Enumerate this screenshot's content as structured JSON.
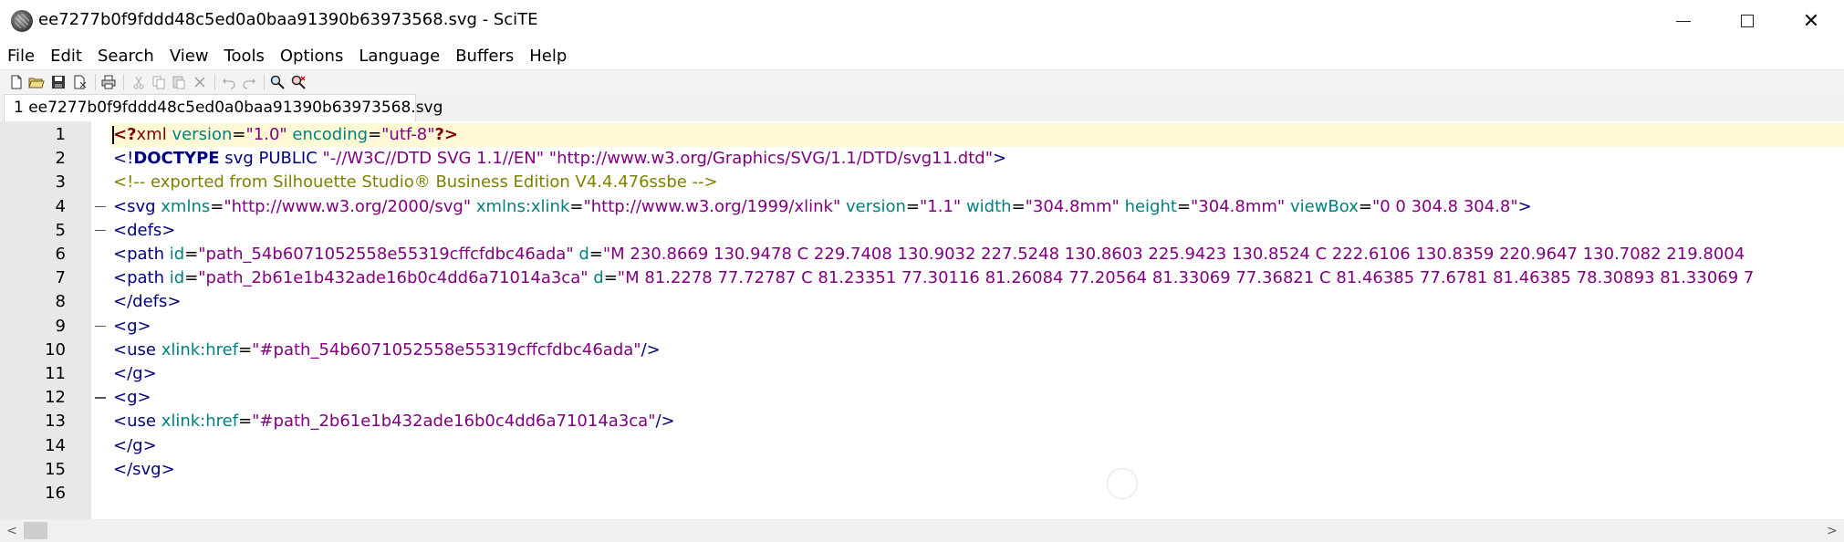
{
  "window": {
    "title": "ee7277b0f9fddd48c5ed0a0baa91390b63973568.svg - SciTE",
    "minimize_label": "",
    "close_label": "✕"
  },
  "menu": [
    "File",
    "Edit",
    "Search",
    "View",
    "Tools",
    "Options",
    "Language",
    "Buffers",
    "Help"
  ],
  "toolbar": {
    "icons": [
      "new-file-icon",
      "open-folder-icon",
      "save-icon",
      "save-as-icon",
      "print-icon",
      "cut-icon",
      "copy-icon",
      "paste-icon",
      "delete-icon",
      "undo-icon",
      "redo-icon",
      "find-icon",
      "replace-icon"
    ]
  },
  "tabs": [
    {
      "label": "1 ee7277b0f9fddd48c5ed0a0baa91390b63973568.svg"
    }
  ],
  "editor": {
    "lines": [
      {
        "num": "1",
        "segments": [
          {
            "c": "t-pi",
            "t": "<?"
          },
          {
            "c": "t-pi-name",
            "t": "xml"
          },
          {
            "c": "t-plain",
            "t": " "
          },
          {
            "c": "t-attr",
            "t": "version"
          },
          {
            "c": "t-plain",
            "t": "="
          },
          {
            "c": "t-str",
            "t": "\"1.0\""
          },
          {
            "c": "t-plain",
            "t": " "
          },
          {
            "c": "t-attr",
            "t": "encoding"
          },
          {
            "c": "t-plain",
            "t": "="
          },
          {
            "c": "t-str",
            "t": "\"utf-8\""
          },
          {
            "c": "t-pi",
            "t": "?>"
          }
        ]
      },
      {
        "num": "2",
        "segments": [
          {
            "c": "t-doctype",
            "t": "<!"
          },
          {
            "c": "t-doctype-kw",
            "t": "DOCTYPE"
          },
          {
            "c": "t-doctype",
            "t": " svg PUBLIC "
          },
          {
            "c": "t-str",
            "t": "\"-//W3C//DTD SVG 1.1//EN\""
          },
          {
            "c": "t-doctype",
            "t": " "
          },
          {
            "c": "t-str",
            "t": "\"http://www.w3.org/Graphics/SVG/1.1/DTD/svg11.dtd\""
          },
          {
            "c": "t-doctype",
            "t": ">"
          }
        ]
      },
      {
        "num": "3",
        "segments": [
          {
            "c": "t-comment",
            "t": "<!-- exported from Silhouette Studio® Business Edition V4.4.476ssbe -->"
          }
        ]
      },
      {
        "num": "4",
        "fold": true,
        "segments": [
          {
            "c": "t-tag",
            "t": "<svg"
          },
          {
            "c": "t-plain",
            "t": " "
          },
          {
            "c": "t-attr",
            "t": "xmlns"
          },
          {
            "c": "t-plain",
            "t": "="
          },
          {
            "c": "t-str",
            "t": "\"http://www.w3.org/2000/svg\""
          },
          {
            "c": "t-plain",
            "t": " "
          },
          {
            "c": "t-attr",
            "t": "xmlns:xlink"
          },
          {
            "c": "t-plain",
            "t": "="
          },
          {
            "c": "t-str",
            "t": "\"http://www.w3.org/1999/xlink\""
          },
          {
            "c": "t-plain",
            "t": " "
          },
          {
            "c": "t-attr",
            "t": "version"
          },
          {
            "c": "t-plain",
            "t": "="
          },
          {
            "c": "t-str",
            "t": "\"1.1\""
          },
          {
            "c": "t-plain",
            "t": " "
          },
          {
            "c": "t-attr",
            "t": "width"
          },
          {
            "c": "t-plain",
            "t": "="
          },
          {
            "c": "t-str",
            "t": "\"304.8mm\""
          },
          {
            "c": "t-plain",
            "t": " "
          },
          {
            "c": "t-attr",
            "t": "height"
          },
          {
            "c": "t-plain",
            "t": "="
          },
          {
            "c": "t-str",
            "t": "\"304.8mm\""
          },
          {
            "c": "t-plain",
            "t": " "
          },
          {
            "c": "t-attr",
            "t": "viewBox"
          },
          {
            "c": "t-plain",
            "t": "="
          },
          {
            "c": "t-str",
            "t": "\"0 0 304.8 304.8\""
          },
          {
            "c": "t-tag",
            "t": ">"
          }
        ]
      },
      {
        "num": "5",
        "fold": true,
        "segments": [
          {
            "c": "t-tag",
            "t": "<defs>"
          }
        ]
      },
      {
        "num": "6",
        "segments": [
          {
            "c": "t-tag",
            "t": "<path"
          },
          {
            "c": "t-plain",
            "t": " "
          },
          {
            "c": "t-attr",
            "t": "id"
          },
          {
            "c": "t-plain",
            "t": "="
          },
          {
            "c": "t-str",
            "t": "\"path_54b6071052558e55319cffcfdbc46ada\""
          },
          {
            "c": "t-plain",
            "t": " "
          },
          {
            "c": "t-attr",
            "t": "d"
          },
          {
            "c": "t-plain",
            "t": "="
          },
          {
            "c": "t-str",
            "t": "\"M 230.8669 130.9478 C 229.7408 130.9032 227.5248 130.8603 225.9423 130.8524 C 222.6106 130.8359 220.9647 130.7082 219.8004 "
          }
        ]
      },
      {
        "num": "7",
        "segments": [
          {
            "c": "t-tag",
            "t": "<path"
          },
          {
            "c": "t-plain",
            "t": " "
          },
          {
            "c": "t-attr",
            "t": "id"
          },
          {
            "c": "t-plain",
            "t": "="
          },
          {
            "c": "t-str",
            "t": "\"path_2b61e1b432ade16b0c4dd6a71014a3ca\""
          },
          {
            "c": "t-plain",
            "t": " "
          },
          {
            "c": "t-attr",
            "t": "d"
          },
          {
            "c": "t-plain",
            "t": "="
          },
          {
            "c": "t-str",
            "t": "\"M 81.2278 77.72787 C 81.23351 77.30116 81.26084 77.20564 81.33069 77.36821 C 81.46385 77.6781 81.46385 78.30893 81.33069 7"
          }
        ]
      },
      {
        "num": "8",
        "segments": [
          {
            "c": "t-tag",
            "t": "</defs>"
          }
        ]
      },
      {
        "num": "9",
        "fold": true,
        "segments": [
          {
            "c": "t-tag",
            "t": "<g>"
          }
        ]
      },
      {
        "num": "10",
        "segments": [
          {
            "c": "t-tag",
            "t": "<use"
          },
          {
            "c": "t-plain",
            "t": " "
          },
          {
            "c": "t-attr",
            "t": "xlink:href"
          },
          {
            "c": "t-plain",
            "t": "="
          },
          {
            "c": "t-str",
            "t": "\"#path_54b6071052558e55319cffcfdbc46ada\""
          },
          {
            "c": "t-tag",
            "t": "/>"
          }
        ]
      },
      {
        "num": "11",
        "segments": [
          {
            "c": "t-tag",
            "t": "</g>"
          }
        ]
      },
      {
        "num": "12",
        "fold": true,
        "segments": [
          {
            "c": "t-tag",
            "t": "<g>"
          }
        ]
      },
      {
        "num": "13",
        "segments": [
          {
            "c": "t-tag",
            "t": "<use"
          },
          {
            "c": "t-plain",
            "t": " "
          },
          {
            "c": "t-attr",
            "t": "xlink:href"
          },
          {
            "c": "t-plain",
            "t": "="
          },
          {
            "c": "t-str",
            "t": "\"#path_2b61e1b432ade16b0c4dd6a71014a3ca\""
          },
          {
            "c": "t-tag",
            "t": "/>"
          }
        ]
      },
      {
        "num": "14",
        "segments": [
          {
            "c": "t-tag",
            "t": "</g>"
          }
        ]
      },
      {
        "num": "15",
        "segments": [
          {
            "c": "t-tag",
            "t": "</svg>"
          }
        ]
      },
      {
        "num": "16",
        "segments": []
      }
    ]
  },
  "scrollbar": {
    "left_arrow": "<",
    "right_arrow": ">"
  }
}
